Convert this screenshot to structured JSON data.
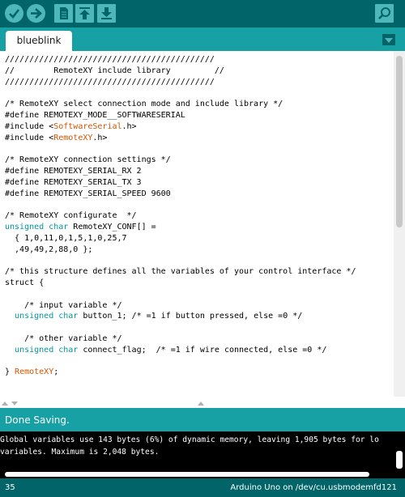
{
  "toolbar": {
    "buttons": [
      {
        "name": "verify",
        "icon": "check-icon"
      },
      {
        "name": "upload",
        "icon": "arrow-right-icon"
      },
      {
        "name": "new",
        "icon": "new-file-icon"
      },
      {
        "name": "open",
        "icon": "arrow-up-icon"
      },
      {
        "name": "save",
        "icon": "arrow-down-icon"
      },
      {
        "name": "serial-monitor",
        "icon": "magnifier-icon"
      }
    ],
    "colors": {
      "background": "#006468",
      "button": "#4db7bb"
    }
  },
  "tabs": [
    {
      "label": "blueblink",
      "active": true
    }
  ],
  "editor": {
    "lines": [
      "///////////////////////////////////////////",
      "//        RemoteXY include library         //",
      "///////////////////////////////////////////",
      "",
      "/* RemoteXY select connection mode and include library */",
      "#define REMOTEXY_MODE__SOFTWARESERIAL",
      "#include <SoftwareSerial.h>",
      "#include <RemoteXY.h>",
      "",
      "/* RemoteXY connection settings */",
      "#define REMOTEXY_SERIAL_RX 2",
      "#define REMOTEXY_SERIAL_TX 3",
      "#define REMOTEXY_SERIAL_SPEED 9600",
      "",
      "/* RemoteXY configurate  */",
      "unsigned char RemoteXY_CONF[] =",
      "  { 1,0,11,0,1,5,1,0,25,7",
      "  ,49,49,2,88,0 };",
      "",
      "/* this structure defines all the variables of your control interface */",
      "struct {",
      "",
      "    /* input variable */",
      "  unsigned char button_1; /* =1 if button pressed, else =0 */",
      "",
      "    /* other variable */",
      "  unsigned char connect_flag;  /* =1 if wire connected, else =0 */",
      "",
      "} RemoteXY;"
    ],
    "colors": {
      "keyword": "#00979c",
      "library": "#d35400"
    }
  },
  "status": {
    "message": "Done Saving."
  },
  "console": {
    "lines": [
      "Global variables use 143 bytes (6%) of dynamic memory, leaving 1,905 bytes for lo",
      "variables. Maximum is 2,048 bytes."
    ]
  },
  "footer": {
    "line_number": "35",
    "board": "Arduino Uno on /dev/cu.usbmodemfd121"
  }
}
